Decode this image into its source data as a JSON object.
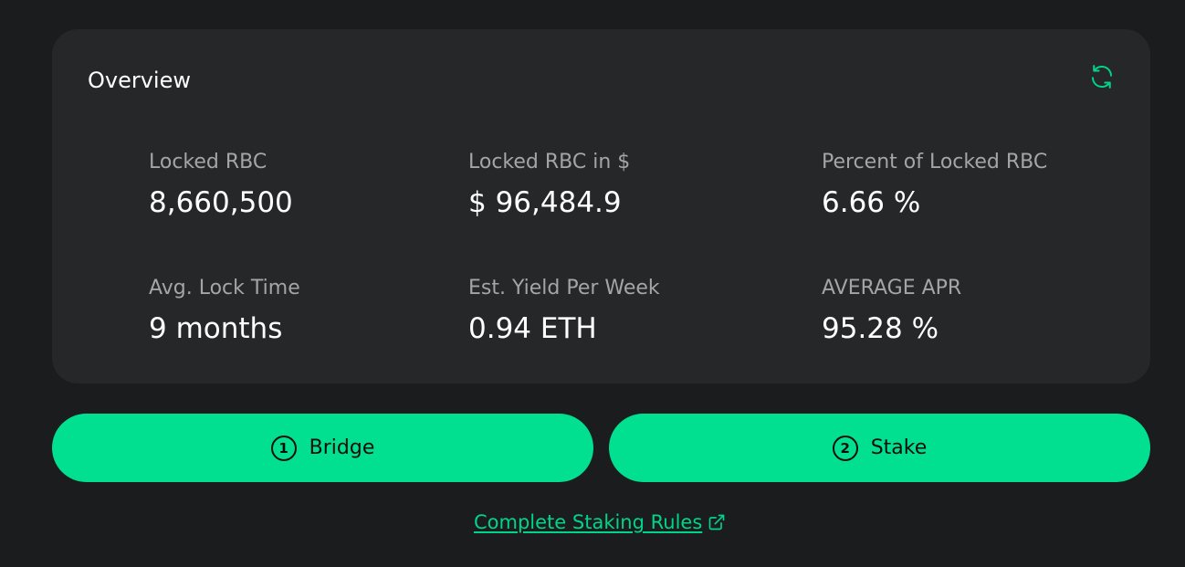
{
  "overview": {
    "title": "Overview",
    "refresh_icon": "refresh-icon",
    "accent_color": "#00e090",
    "stats": [
      {
        "label": "Locked RBC",
        "value": "8,660,500"
      },
      {
        "label": "Locked RBC in $",
        "value": "$ 96,484.9"
      },
      {
        "label": "Percent of Locked RBC",
        "value": "6.66 %"
      },
      {
        "label": "Avg. Lock Time",
        "value": "9 months"
      },
      {
        "label": "Est. Yield Per Week",
        "value": "0.94 ETH"
      },
      {
        "label": "AVERAGE APR",
        "value": "95.28 %"
      }
    ]
  },
  "actions": {
    "bridge": {
      "step": "1",
      "label": "Bridge"
    },
    "stake": {
      "step": "2",
      "label": "Stake"
    }
  },
  "footer": {
    "rules_link": "Complete Staking Rules",
    "rules_icon": "external-link-icon"
  }
}
